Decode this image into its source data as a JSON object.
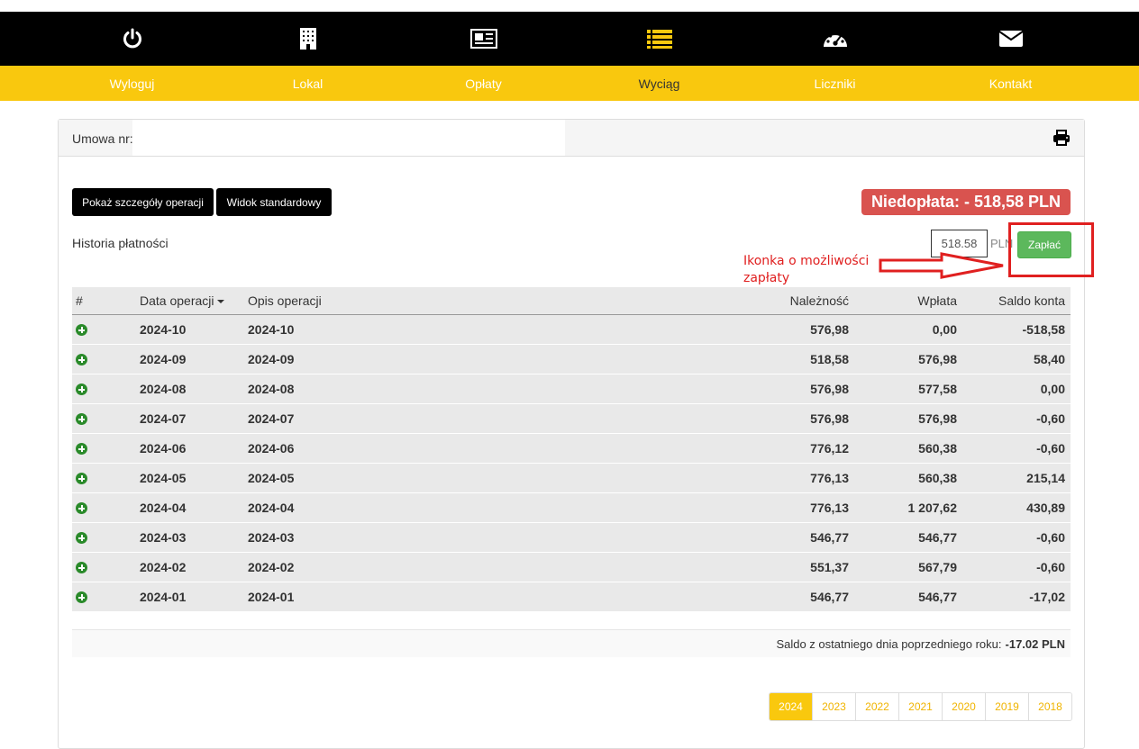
{
  "nav": [
    {
      "icon": "power-icon",
      "label": "Wyloguj"
    },
    {
      "icon": "building-icon",
      "label": "Lokal"
    },
    {
      "icon": "newspaper-icon",
      "label": "Opłaty"
    },
    {
      "icon": "list-icon",
      "label": "Wyciąg"
    },
    {
      "icon": "dashboard-icon",
      "label": "Liczniki"
    },
    {
      "icon": "envelope-icon",
      "label": "Kontakt"
    }
  ],
  "active_nav": "Wyciąg",
  "panel": {
    "umowa_label": "Umowa nr:",
    "umowa_value": ""
  },
  "buttons": {
    "details": "Pokaż szczegóły operacji",
    "standard": "Widok standardowy",
    "pay": "Zapłać"
  },
  "underpayment": "Niedopłata: - 518,58 PLN",
  "history_label": "Historia płatności",
  "amount_value": "518.58",
  "currency": "PLN",
  "annotation": {
    "line1": "Ikonka o możliwości",
    "line2": "zapłaty"
  },
  "table": {
    "headers": [
      "#",
      "Data operacji",
      "Opis operacji",
      "Należność",
      "Wpłata",
      "Saldo konta"
    ],
    "rows": [
      {
        "date": "2024-10",
        "desc": "2024-10",
        "due": "576,98",
        "paid": "0,00",
        "balance": "-518,58"
      },
      {
        "date": "2024-09",
        "desc": "2024-09",
        "due": "518,58",
        "paid": "576,98",
        "balance": "58,40"
      },
      {
        "date": "2024-08",
        "desc": "2024-08",
        "due": "576,98",
        "paid": "577,58",
        "balance": "0,00"
      },
      {
        "date": "2024-07",
        "desc": "2024-07",
        "due": "576,98",
        "paid": "576,98",
        "balance": "-0,60"
      },
      {
        "date": "2024-06",
        "desc": "2024-06",
        "due": "776,12",
        "paid": "560,38",
        "balance": "-0,60"
      },
      {
        "date": "2024-05",
        "desc": "2024-05",
        "due": "776,13",
        "paid": "560,38",
        "balance": "215,14"
      },
      {
        "date": "2024-04",
        "desc": "2024-04",
        "due": "776,13",
        "paid": "1 207,62",
        "balance": "430,89"
      },
      {
        "date": "2024-03",
        "desc": "2024-03",
        "due": "546,77",
        "paid": "546,77",
        "balance": "-0,60"
      },
      {
        "date": "2024-02",
        "desc": "2024-02",
        "due": "551,37",
        "paid": "567,79",
        "balance": "-0,60"
      },
      {
        "date": "2024-01",
        "desc": "2024-01",
        "due": "546,77",
        "paid": "546,77",
        "balance": "-17,02"
      }
    ]
  },
  "saldo": {
    "label": "Saldo z ostatniego dnia poprzedniego roku:",
    "value": "-17.02 PLN"
  },
  "years": [
    "2024",
    "2023",
    "2022",
    "2021",
    "2020",
    "2019",
    "2018"
  ],
  "colors": {
    "accent": "#f9c80e",
    "danger": "#d9534f",
    "success": "#5cb85c",
    "annotation": "#e02020"
  }
}
